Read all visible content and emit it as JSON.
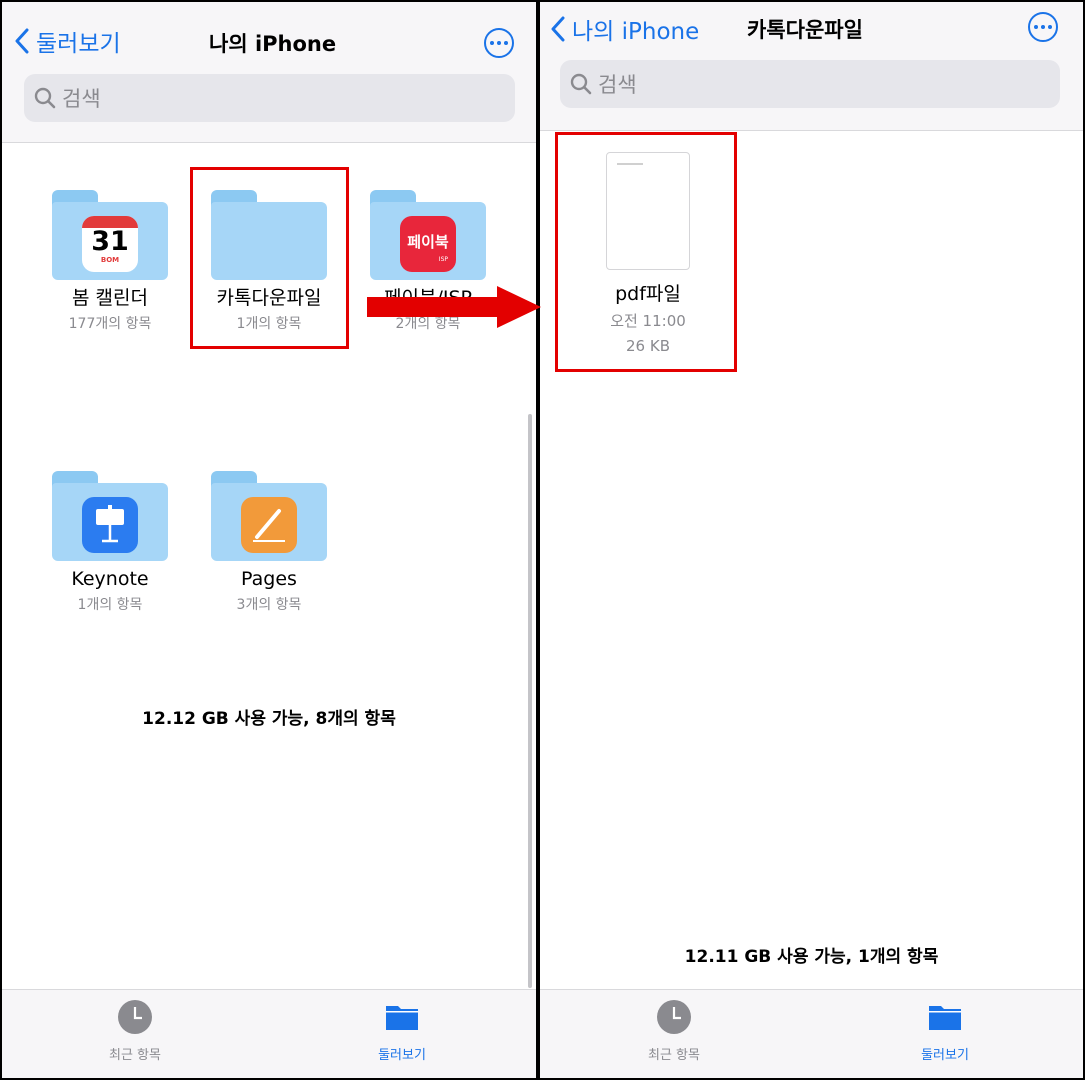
{
  "left": {
    "back_label": "둘러보기",
    "title": "나의 iPhone",
    "search_placeholder": "검색",
    "folders": [
      {
        "name": "봄 캘린더",
        "sub": "177개의 항목",
        "icon": "calendar-app-icon",
        "badge_text": "31",
        "badge_sub": "BOM"
      },
      {
        "name": "카톡다운파일",
        "sub": "1개의 항목",
        "icon": "folder-icon"
      },
      {
        "name": "페이북/ISP",
        "sub": "2개의 항목",
        "icon": "paybook-app-icon",
        "badge_text": "페이북",
        "badge_sub": "ISP"
      },
      {
        "name": "Keynote",
        "sub": "1개의 항목",
        "icon": "keynote-app-icon"
      },
      {
        "name": "Pages",
        "sub": "3개의 항목",
        "icon": "pages-app-icon"
      }
    ],
    "footer": "12.12 GB 사용 가능, 8개의 항목",
    "tabs": [
      {
        "label": "최근 항목"
      },
      {
        "label": "둘러보기"
      }
    ]
  },
  "right": {
    "back_label": "나의 iPhone",
    "title": "카톡다운파일",
    "search_placeholder": "검색",
    "file": {
      "name": "pdf파일",
      "time": "오전 11:00",
      "size": "26 KB"
    },
    "footer": "12.11 GB 사용 가능, 1개의 항목",
    "tabs": [
      {
        "label": "최근 항목"
      },
      {
        "label": "둘러보기"
      }
    ]
  },
  "colors": {
    "accent": "#1a73e8",
    "highlight": "#e30000",
    "folder": "#a6d6f7"
  }
}
